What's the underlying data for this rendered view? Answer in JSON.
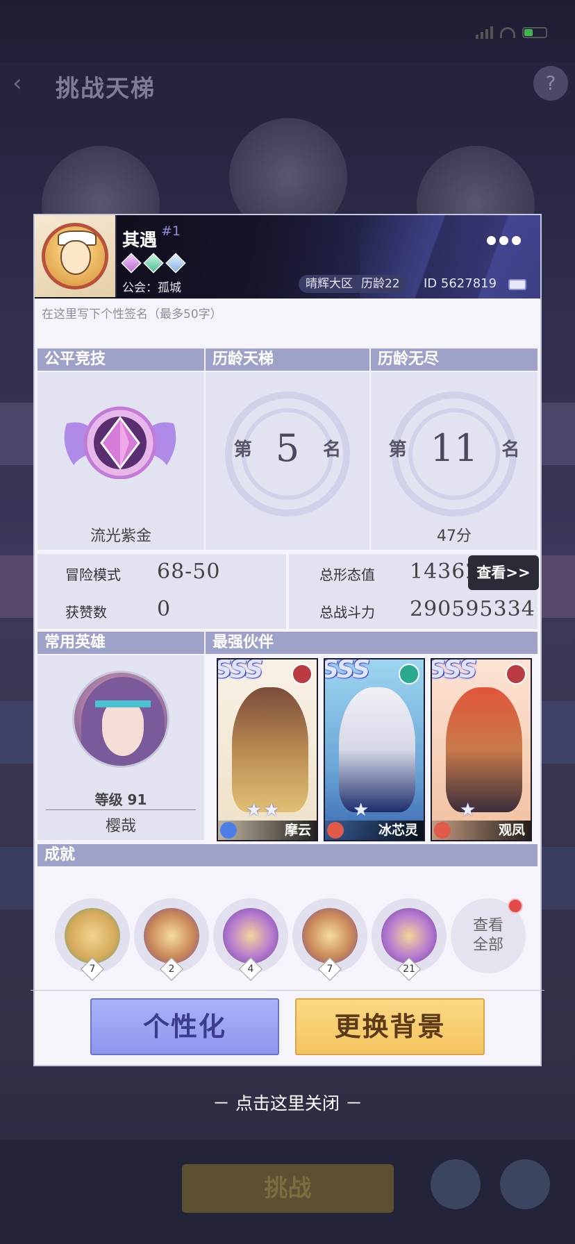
{
  "background": {
    "title": "挑战天梯",
    "subtitle": "",
    "bottom_button": "挑战"
  },
  "profile": {
    "name": "其遇",
    "rank_tag": "#1",
    "guild_label": "公会：",
    "guild_name": "孤城",
    "server": "晴辉大区",
    "age": "历龄22",
    "id": "ID 5627819",
    "signature_placeholder": "在这里写下个性签名（最多50字）"
  },
  "sections": {
    "fair": {
      "title": "公平竞技",
      "badge": "流光紫金"
    },
    "ladder": {
      "title": "历龄天梯",
      "prefix": "第",
      "rank": "5",
      "suffix": "名"
    },
    "endless": {
      "title": "历龄无尽",
      "prefix": "第",
      "rank": "11",
      "suffix": "名",
      "score": "47分"
    }
  },
  "stats": {
    "adventure_label": "冒险模式",
    "adventure_value": "68-50",
    "likes_label": "获赞数",
    "likes_value": "0",
    "forms_label": "总形态值",
    "forms_value": "14362",
    "power_label": "总战斗力",
    "power_value": "290595334",
    "view_button": "查看>>"
  },
  "hero": {
    "title": "常用英雄",
    "level": "等级 91",
    "name": "樱哉"
  },
  "partners": {
    "title": "最强伙伴",
    "items": [
      {
        "grade": "SSS",
        "name": "摩云",
        "stars": "★★"
      },
      {
        "grade": "SSS",
        "name": "冰芯灵",
        "stars": "★"
      },
      {
        "grade": "SSS",
        "name": "观凤",
        "stars": "★"
      }
    ]
  },
  "achievements": {
    "title": "成就",
    "items": [
      {
        "count": "7"
      },
      {
        "count": "2"
      },
      {
        "count": "4"
      },
      {
        "count": "7"
      },
      {
        "count": "21"
      }
    ],
    "view_all_line1": "查看",
    "view_all_line2": "全部"
  },
  "buttons": {
    "personalize": "个性化",
    "change_bg": "更换背景"
  },
  "close_hint": "－ 点击这里关闭 －",
  "colors": {
    "section_bar": "#9fa2c8",
    "panel": "#e2e3f1",
    "personalize": "#9aa2f2",
    "change_bg": "#f6cb6a"
  }
}
